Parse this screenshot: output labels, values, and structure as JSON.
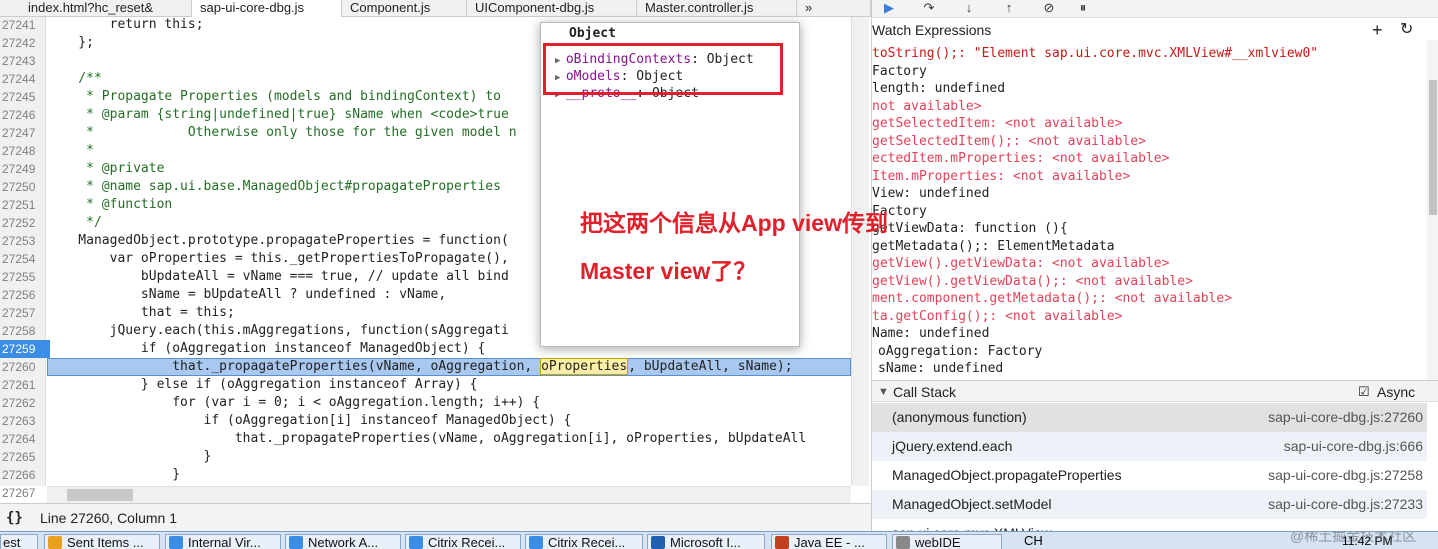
{
  "tabs": [
    "index.html?hc_reset&",
    "sap-ui-core-dbg.js",
    "Component.js",
    "UIComponent-dbg.js",
    "Master.controller.js",
    "»"
  ],
  "code": {
    "lines": [
      {
        "n": "27241",
        "t": "        return this;"
      },
      {
        "n": "27242",
        "t": "    };"
      },
      {
        "n": "27243",
        "t": ""
      },
      {
        "n": "27244",
        "t": "    /**",
        "c": "cm"
      },
      {
        "n": "27245",
        "t": "     * Propagate Properties (models and bindingContext) to",
        "c": "cm"
      },
      {
        "n": "27246",
        "t": "     * @param {string|undefined|true} sName when <code>true",
        "c": "cm"
      },
      {
        "n": "27247",
        "t": "     *            Otherwise only those for the given model n",
        "c": "cm"
      },
      {
        "n": "27248",
        "t": "     *",
        "c": "cm"
      },
      {
        "n": "27249",
        "t": "     * @private",
        "c": "cm"
      },
      {
        "n": "27250",
        "t": "     * @name sap.ui.base.ManagedObject#propagateProperties",
        "c": "cm"
      },
      {
        "n": "27251",
        "t": "     * @function",
        "c": "cm"
      },
      {
        "n": "27252",
        "t": "     */",
        "c": "cm"
      },
      {
        "n": "27253",
        "t": "    ManagedObject.prototype.propagateProperties = function("
      },
      {
        "n": "27254",
        "t": "        var oProperties = this._getPropertiesToPropagate(),"
      },
      {
        "n": "27255",
        "t": "            bUpdateAll = vName === true, // update all bind"
      },
      {
        "n": "27256",
        "t": "            sName = bUpdateAll ? undefined : vName,"
      },
      {
        "n": "27257",
        "t": "            that = this;"
      },
      {
        "n": "27258",
        "t": "        jQuery.each(this.mAggregations, function(sAggregati"
      },
      {
        "n": "27259",
        "t": "            if (oAggregation instanceof ManagedObject) {",
        "bp": true
      },
      {
        "n": "27260",
        "t": "                that._propagateProperties(vName, oAggregation, oProperties, bUpdateAll, sName);",
        "hl": true
      },
      {
        "n": "27261",
        "t": "            } else if (oAggregation instanceof Array) {"
      },
      {
        "n": "27262",
        "t": "                for (var i = 0; i < oAggregation.length; i++) {"
      },
      {
        "n": "27263",
        "t": "                    if (oAggregation[i] instanceof ManagedObject) {"
      },
      {
        "n": "27264",
        "t": "                        that._propagateProperties(vName, oAggregation[i], oProperties, bUpdateAll"
      },
      {
        "n": "27265",
        "t": "                    }"
      },
      {
        "n": "27266",
        "t": "                }"
      },
      {
        "n": "27267",
        "t": "            }"
      }
    ]
  },
  "status": {
    "braces": "{}",
    "position": "Line 27260, Column 1"
  },
  "popup": {
    "title": "Object",
    "rows": [
      {
        "k": "oBindingContexts",
        "v": ": Object"
      },
      {
        "k": "oModels",
        "v": ": Object"
      },
      {
        "k": "__proto__",
        "v": ": Object"
      }
    ]
  },
  "annotation": {
    "line1": "把这两个信息从App view传到",
    "line2": "Master view了？"
  },
  "watch": {
    "header": "Watch Expressions",
    "rows": [
      {
        "t": "toString();: \"Element sap.ui.core.mvc.XMLView#__xmlview0\"",
        "c": "fs"
      },
      {
        "t": "Factory"
      },
      {
        "t": "length: undefined"
      },
      {
        "t": "not available>",
        "c": "na"
      },
      {
        "t": "getSelectedItem: <not available>",
        "c": "na"
      },
      {
        "t": "getSelectedItem();: <not available>",
        "c": "na"
      },
      {
        "t": "ectedItem.mProperties: <not available>",
        "c": "na"
      },
      {
        "t": "Item.mProperties: <not available>",
        "c": "na"
      },
      {
        "t": "View: undefined"
      },
      {
        "t": "Factory"
      },
      {
        "t": "getViewData: function (){"
      },
      {
        "t": "getMetadata();: ElementMetadata"
      },
      {
        "t": "getView().getViewData: <not available>",
        "c": "na"
      },
      {
        "t": "getView().getViewData();: <not available>",
        "c": "na"
      },
      {
        "t": "ment.component.getMetadata();: <not available>",
        "c": "na"
      },
      {
        "t": "ta.getConfig();: <not available>",
        "c": "na"
      },
      {
        "t": "Name: undefined"
      },
      {
        "t": "oAggregation: Factory"
      },
      {
        "t": "sName: undefined"
      }
    ]
  },
  "callstack": {
    "header": "Call Stack",
    "async": "Async",
    "frames": [
      {
        "f": "(anonymous function)",
        "loc": "sap-ui-core-dbg.js:27260"
      },
      {
        "f": "jQuery.extend.each",
        "loc": "sap-ui-core-dbg.js:666"
      },
      {
        "f": "ManagedObject.propagateProperties",
        "loc": "sap-ui-core-dbg.js:27258"
      },
      {
        "f": "ManagedObject.setModel",
        "loc": "sap-ui-core-dbg.js:27233"
      },
      {
        "f": "sap.ui.core.mvc.XMLView...",
        "loc": ""
      }
    ]
  },
  "taskbar": {
    "items": [
      "est",
      "Sent Items ...",
      "Internal Vir...",
      "Network A...",
      "Citrix Recei...",
      "Citrix Recei...",
      "Microsoft I...",
      "Java EE - ...",
      "webIDE"
    ],
    "lang": "CH",
    "clock": "11:42 PM",
    "watermark": "@稀土掘金技术社区"
  }
}
